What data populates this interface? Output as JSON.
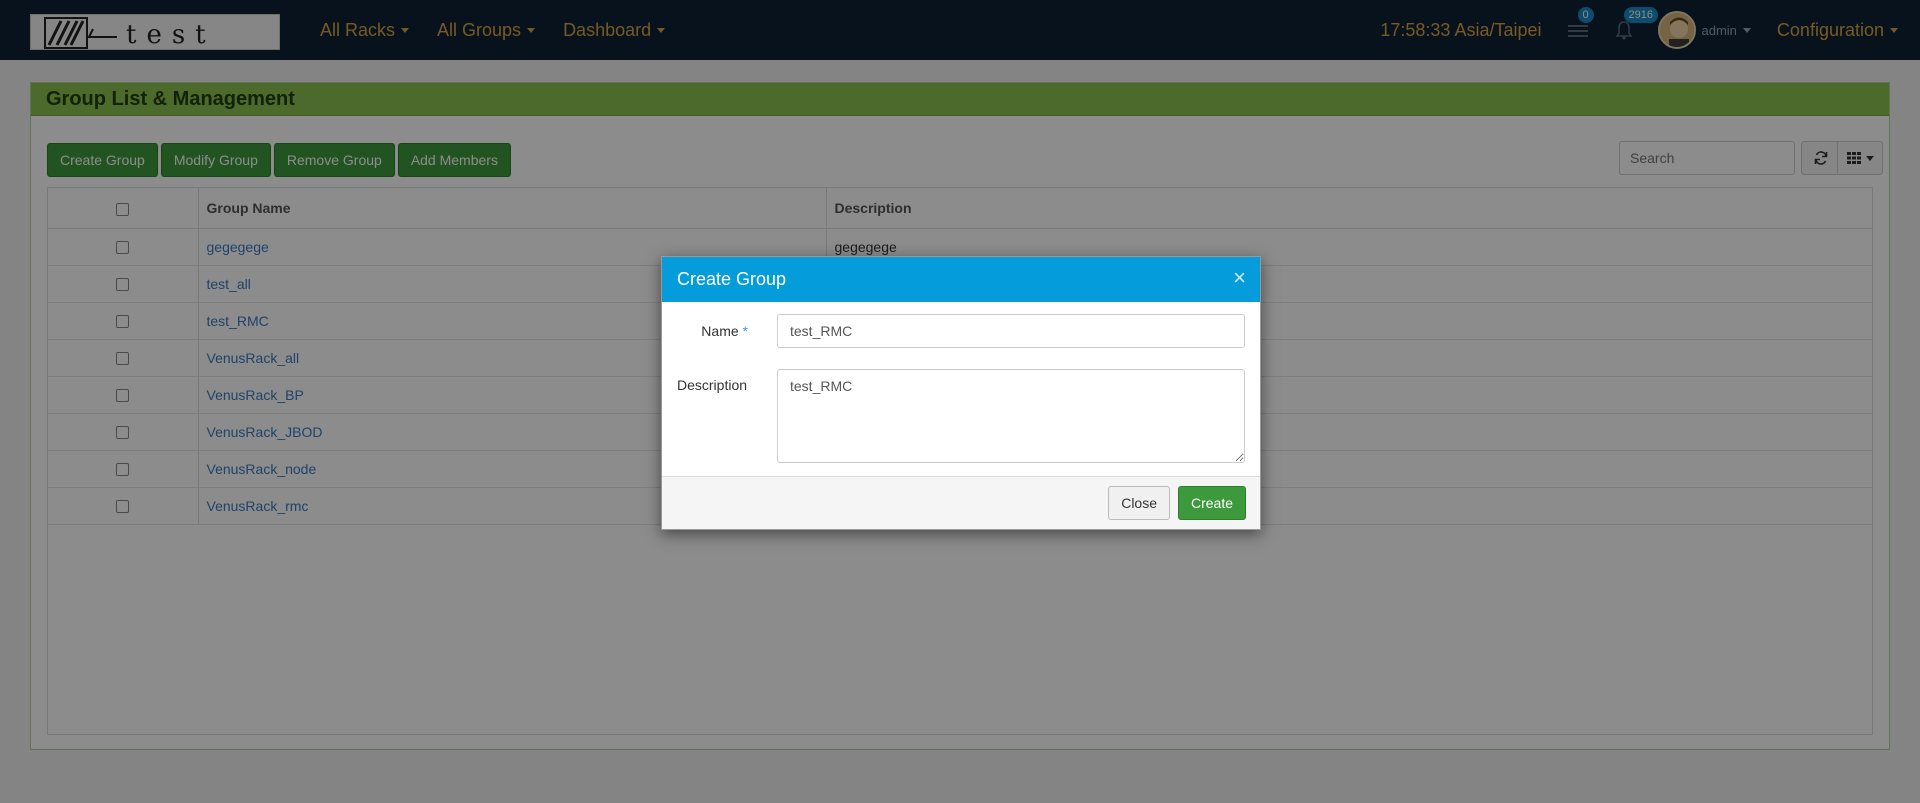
{
  "navbar": {
    "logo_text": "test",
    "menu": [
      {
        "label": "All Racks"
      },
      {
        "label": "All Groups"
      },
      {
        "label": "Dashboard"
      }
    ],
    "clock": "17:58:33 Asia/Taipei",
    "messages_badge": "0",
    "alerts_badge": "2916",
    "user": "admin",
    "config": "Configuration"
  },
  "panel": {
    "title": "Group List & Management"
  },
  "toolbar": {
    "create": "Create Group",
    "modify": "Modify Group",
    "remove": "Remove Group",
    "add_members": "Add Members",
    "search_placeholder": "Search"
  },
  "table": {
    "headers": [
      "",
      "Group Name",
      "Description"
    ],
    "rows": [
      {
        "name": "gegegege",
        "description": "gegegege"
      },
      {
        "name": "test_all",
        "description": ""
      },
      {
        "name": "test_RMC",
        "description": ""
      },
      {
        "name": "VenusRack_all",
        "description": ""
      },
      {
        "name": "VenusRack_BP",
        "description": ""
      },
      {
        "name": "VenusRack_JBOD",
        "description": ""
      },
      {
        "name": "VenusRack_node",
        "description": ""
      },
      {
        "name": "VenusRack_rmc",
        "description": ""
      }
    ]
  },
  "modal": {
    "title": "Create Group",
    "close_symbol": "×",
    "name_label": "Name",
    "required_mark": "*",
    "name_value": "test_RMC",
    "description_label": "Description",
    "description_value": "test_RMC",
    "close_button": "Close",
    "create_button": "Create"
  },
  "colors": {
    "navbar_bg": "#0d2236",
    "nav_text": "#d9a441",
    "panel_heading": "#8cc152",
    "modal_header": "#049cdb",
    "button_green": "#3c9a3c",
    "link": "#3a7abf"
  }
}
